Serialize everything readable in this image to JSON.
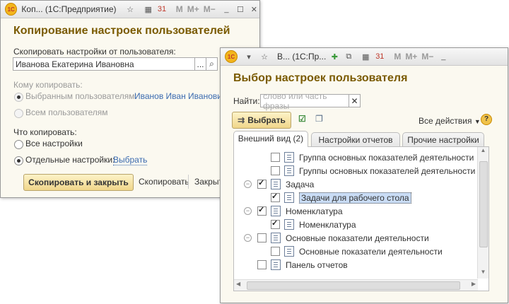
{
  "win1": {
    "title": "Коп...  (1С:Предприятие)",
    "m_buttons": [
      "M",
      "M+",
      "M−"
    ],
    "heading": "Копирование настроек пользователей",
    "copy_from_label": "Скопировать настройки от пользователя:",
    "copy_from_value": "Иванова Екатерина Ивановна",
    "ellipsis": "...",
    "whom_label": "Кому копировать:",
    "selected_users_label": "Выбранным пользователям:",
    "selected_users_link": "Иванов Иван Иванович",
    "all_users_label": "Всем пользователям",
    "what_label": "Что копировать:",
    "all_settings_label": "Все настройки",
    "separate_settings_label": "Отдельные настройки:",
    "choose_link": "Выбрать",
    "copy_close_button": "Скопировать и закрыть",
    "copy_button": "Скопировать",
    "close_button": "Закрыть"
  },
  "win2": {
    "title": "В...  (1С:Пр...",
    "m_buttons": [
      "M",
      "M+",
      "M−"
    ],
    "heading": "Выбор настроек пользователя",
    "search_label": "Найти:",
    "search_placeholder": "слово или часть фразы",
    "choose_button": "Выбрать",
    "all_actions": "Все действия",
    "help": "?",
    "tabs": [
      {
        "label": "Внешний вид (2)"
      },
      {
        "label": "Настройки отчетов"
      },
      {
        "label": "Прочие настройки"
      }
    ],
    "tree": [
      {
        "label": "Группа основных показателей деятельности",
        "checked": false
      },
      {
        "label": "Группы основных показателей деятельности (спис",
        "checked": false
      },
      {
        "label": "Задача",
        "checked": true
      },
      {
        "label": "Задачи для рабочего стола",
        "checked": true
      },
      {
        "label": "Номенклатура",
        "checked": true
      },
      {
        "label": "Номенклатура",
        "checked": true
      },
      {
        "label": "Основные показатели деятельности",
        "checked": false
      },
      {
        "label": "Основные показатели деятельности",
        "checked": false
      },
      {
        "label": "Панель отчетов",
        "checked": false
      }
    ]
  }
}
